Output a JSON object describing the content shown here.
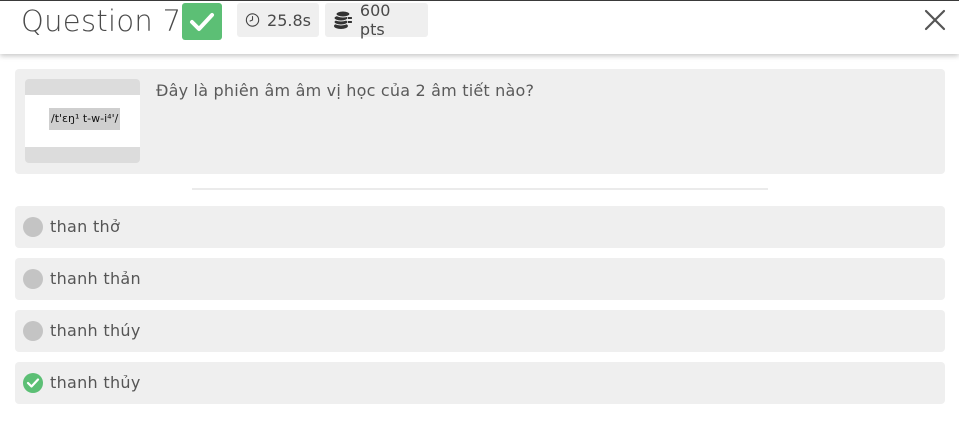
{
  "header": {
    "question_title": "Question 7",
    "timer": "25.8s",
    "points": "600 pts",
    "accent_color": "#5cbf75",
    "icons": {
      "status": "check-icon",
      "timer": "clock-icon",
      "points": "coins-icon",
      "close": "close-icon"
    }
  },
  "question": {
    "text": "Đây là phiên âm âm vị học của 2 âm tiết nào?",
    "image_text": "/t'ɛŋ¹ t-w-i⁴'/"
  },
  "options": [
    {
      "label": "than thở",
      "state": "unselected"
    },
    {
      "label": "thanh thản",
      "state": "unselected"
    },
    {
      "label": "thanh thúy",
      "state": "unselected"
    },
    {
      "label": "thanh thủy",
      "state": "correct"
    }
  ]
}
